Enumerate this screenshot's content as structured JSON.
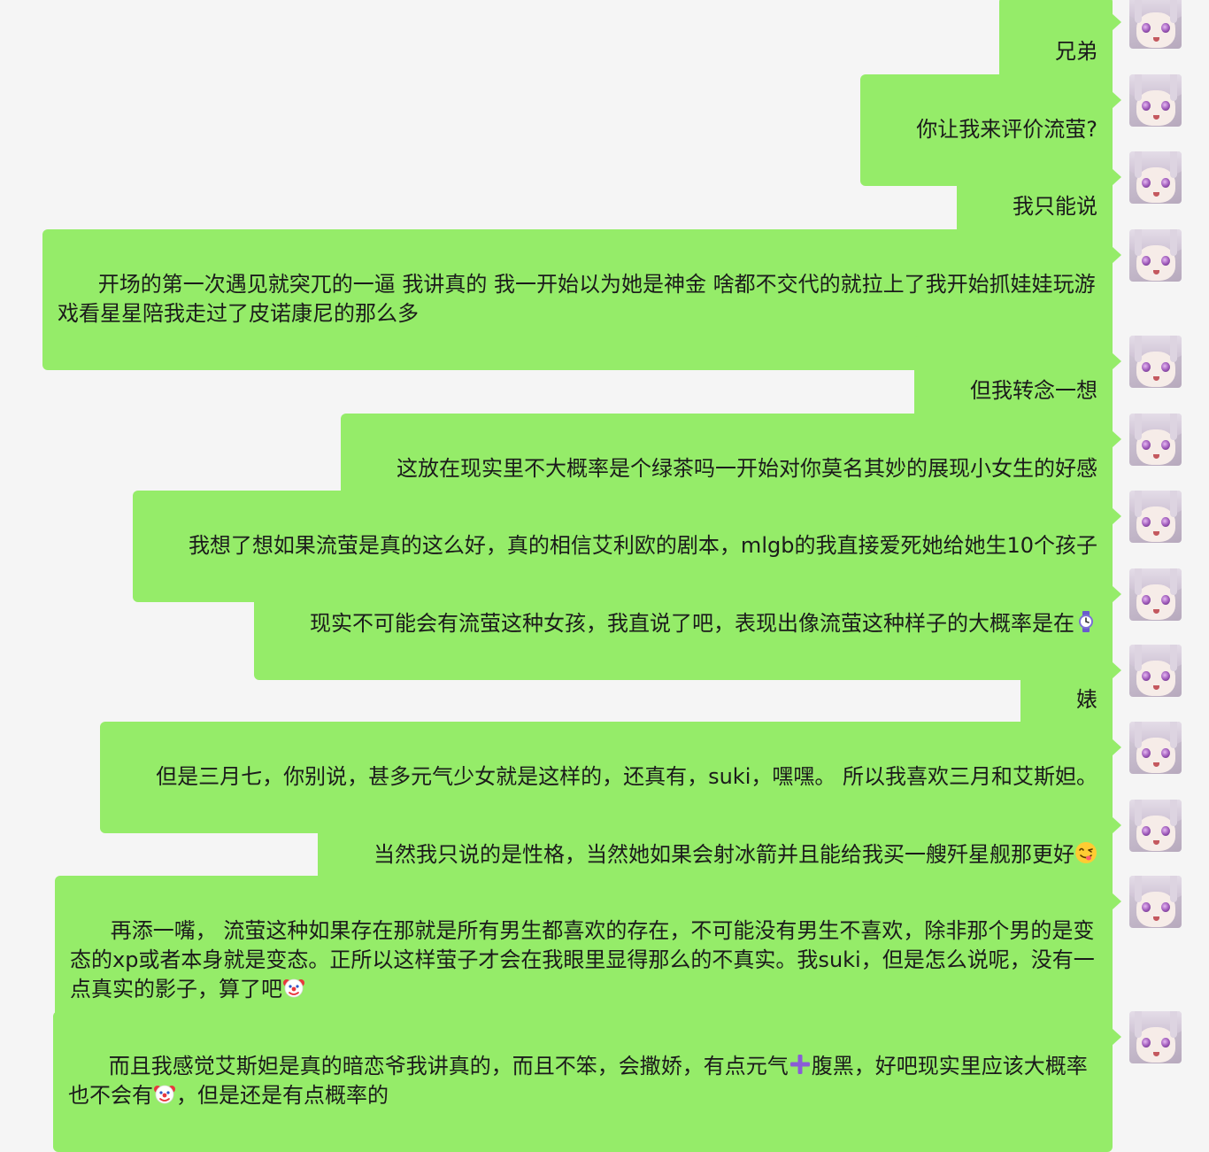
{
  "chat": {
    "messages": [
      {
        "text": "兄弟"
      },
      {
        "text": "你让我来评价流萤?"
      },
      {
        "text": "我只能说"
      },
      {
        "text": "开场的第一次遇见就突兀的一逼 我讲真的 我一开始以为她是神金 啥都不交代的就拉上了我开始抓娃娃玩游戏看星星陪我走过了皮诺康尼的那么多"
      },
      {
        "text": "但我转念一想"
      },
      {
        "text": "这放在现实里不大概率是个绿茶吗一开始对你莫名其妙的展现小女生的好感"
      },
      {
        "text": "我想了想如果流萤是真的这么好，真的相信艾利欧的剧本，mlgb的我直接爱死她给她生10个孩子"
      },
      {
        "text": "现实不可能会有流萤这种女孩，我直说了吧，表现出像流萤这种样子的大概率是在",
        "emoji_after": "watch-emoji"
      },
      {
        "text": "婊"
      },
      {
        "text": "但是三月七，你别说，甚多元气少女就是这样的，还真有，suki，嘿嘿。 所以我喜欢三月和艾斯妲。"
      },
      {
        "text": "当然我只说的是性格，当然她如果会射冰箭并且能给我买一艘歼星舰那更好",
        "emoji_after": "yum-face-emoji"
      },
      {
        "text": "再添一嘴， 流萤这种如果存在那就是所有男生都喜欢的存在，不可能没有男生不喜欢，除非那个男的是变态的xp或者本身就是变态。正所以这样萤子才会在我眼里显得那么的不真实。我suki，但是怎么说呢，没有一点真实的影子，算了吧",
        "emoji_after": "clown-emoji"
      },
      {
        "text_part1": "而且我感觉艾斯妲是真的暗恋爷我讲真的，而且不笨，会撒娇，有点元气",
        "emoji_mid": "plus-emoji",
        "text_part2": "腹黑，好吧现实里应该大概率也不会有",
        "emoji_mid2": "clown-emoji",
        "text_part3": "，但是还是有点概率的"
      }
    ],
    "colors": {
      "background": "#f5f5f5",
      "bubble": "#95ec69",
      "text": "#1b1b1b"
    },
    "avatar_icon": "anime-girl-avatar-icon"
  }
}
